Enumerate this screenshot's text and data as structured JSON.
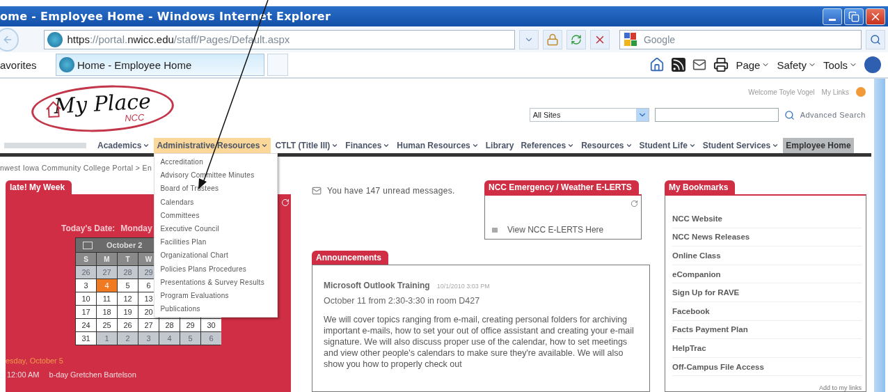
{
  "window": {
    "title": "ome - Employee Home - Windows Internet Explorer"
  },
  "address_bar": {
    "scheme": "https",
    "faded_start": "://portal.",
    "domain": "nwicc.edu",
    "faded_end": "/staff/Pages/Default.aspx"
  },
  "search_box": {
    "placeholder": "Google"
  },
  "favorites": {
    "label": "avorites",
    "tabs": [
      {
        "title": "Home - Employee Home",
        "selected": true
      }
    ]
  },
  "command_bar": [
    "Page",
    "Safety",
    "Tools"
  ],
  "portal": {
    "logo": {
      "title": "My Place",
      "subtitle": "NCC"
    },
    "user_links": [
      "Welcome Toyle Vogel",
      "My Links"
    ],
    "search": {
      "scope": "All Sites",
      "action": "Advanced Search"
    },
    "nav": [
      {
        "label": "Academics",
        "dropdown": true,
        "expanded": false,
        "selected": false
      },
      {
        "label": "Administrative Resources",
        "dropdown": true,
        "expanded": true,
        "selected": false
      },
      {
        "label": "CTLT (Title III)",
        "dropdown": true,
        "expanded": false,
        "selected": false
      },
      {
        "label": "Finances",
        "dropdown": true,
        "expanded": false,
        "selected": false
      },
      {
        "label": "Human Resources",
        "dropdown": true,
        "expanded": false,
        "selected": false
      },
      {
        "label": "Library",
        "dropdown": false,
        "expanded": false,
        "selected": false
      },
      {
        "label": "References",
        "dropdown": true,
        "expanded": false,
        "selected": false
      },
      {
        "label": "Resources",
        "dropdown": true,
        "expanded": false,
        "selected": false
      },
      {
        "label": "Student Life",
        "dropdown": true,
        "expanded": false,
        "selected": false
      },
      {
        "label": "Student Services",
        "dropdown": true,
        "expanded": false,
        "selected": false
      },
      {
        "label": "Employee Home",
        "dropdown": false,
        "expanded": false,
        "selected": true
      }
    ],
    "menu": [
      "Accreditation",
      "Advisory Committee Minutes",
      "Board of Trustees",
      "Calendars",
      "Committees",
      "Executive Council",
      "Facilities Plan",
      "Organizational Chart",
      "Policies Plans Procedures",
      "Presentations & Survey Results",
      "Program Evaluations",
      "Publications"
    ],
    "breadcrumb": "nwest Iowa Community College Portal > En",
    "week": {
      "tab": "late! My Week",
      "today_label": "Today's Date:",
      "today": "Monday",
      "month": "October 2",
      "weekdays": [
        "S",
        "M",
        "T",
        "W"
      ],
      "rows": [
        [
          {
            "d": "26",
            "muted": true,
            "selected": false
          },
          {
            "d": "27",
            "muted": true,
            "selected": false
          },
          {
            "d": "28",
            "muted": true,
            "selected": false
          },
          {
            "d": "29",
            "muted": true,
            "selected": false
          }
        ],
        [
          {
            "d": "3",
            "muted": false,
            "selected": false
          },
          {
            "d": "4",
            "muted": false,
            "selected": true
          },
          {
            "d": "5",
            "muted": false,
            "selected": false
          },
          {
            "d": "6",
            "muted": false,
            "selected": false
          }
        ],
        [
          {
            "d": "10",
            "muted": false,
            "selected": false
          },
          {
            "d": "11",
            "muted": false,
            "selected": false
          },
          {
            "d": "12",
            "muted": false,
            "selected": false
          },
          {
            "d": "13",
            "muted": false,
            "selected": false
          }
        ],
        [
          {
            "d": "17",
            "muted": false,
            "selected": false
          },
          {
            "d": "18",
            "muted": false,
            "selected": false
          },
          {
            "d": "19",
            "muted": false,
            "selected": false
          },
          {
            "d": "20",
            "muted": false,
            "selected": false
          }
        ],
        [
          {
            "d": "24",
            "muted": false,
            "selected": false
          },
          {
            "d": "25",
            "muted": false,
            "selected": false
          },
          {
            "d": "26",
            "muted": false,
            "selected": false
          },
          {
            "d": "27",
            "muted": false,
            "selected": false
          },
          {
            "d": "28",
            "muted": false,
            "selected": false
          },
          {
            "d": "29",
            "muted": false,
            "selected": false
          },
          {
            "d": "30",
            "muted": false,
            "selected": false
          }
        ],
        [
          {
            "d": "31",
            "muted": false,
            "selected": false
          },
          {
            "d": "1",
            "muted": true,
            "selected": false
          },
          {
            "d": "2",
            "muted": true,
            "selected": false
          },
          {
            "d": "3",
            "muted": true,
            "selected": false
          },
          {
            "d": "4",
            "muted": true,
            "selected": false
          },
          {
            "d": "5",
            "muted": true,
            "selected": false
          },
          {
            "d": "6",
            "muted": true,
            "selected": false
          }
        ]
      ],
      "day_heading": "esday, October 5",
      "events": [
        {
          "time": "12:00 AM",
          "title": "b-day Gretchen Bartelson"
        }
      ]
    },
    "messages": "You have 147 unread messages.",
    "alerts": {
      "tab": "NCC Emergency / Weather E-LERTS",
      "link": "View NCC E-LERTS Here"
    },
    "announcements": {
      "tab": "Announcements",
      "items": [
        {
          "title": "Microsoft Outlook Training",
          "date": "10/1/2010 3:03 PM",
          "subtitle": "October 11 from 2:30-3:30 in room D427",
          "body": "We will cover topics ranging from e-mail, creating personal folders for archiving important e-mails, how to set your out of office assistant and creating your e-mail signature. We will also discuss proper use of the calendar, how to set meetings and view other people's calendars to make sure they're available. We will also show you how to properly check out"
        }
      ]
    },
    "bookmarks": {
      "tab": "My Bookmarks",
      "items": [
        "NCC Website",
        "NCC News Releases",
        "Online Class",
        "eCompanion",
        "Sign Up for RAVE",
        "Facebook",
        "Facts Payment Plan",
        "HelpTrac",
        "Off-Campus File Access"
      ],
      "footer": "Add to my links"
    }
  }
}
